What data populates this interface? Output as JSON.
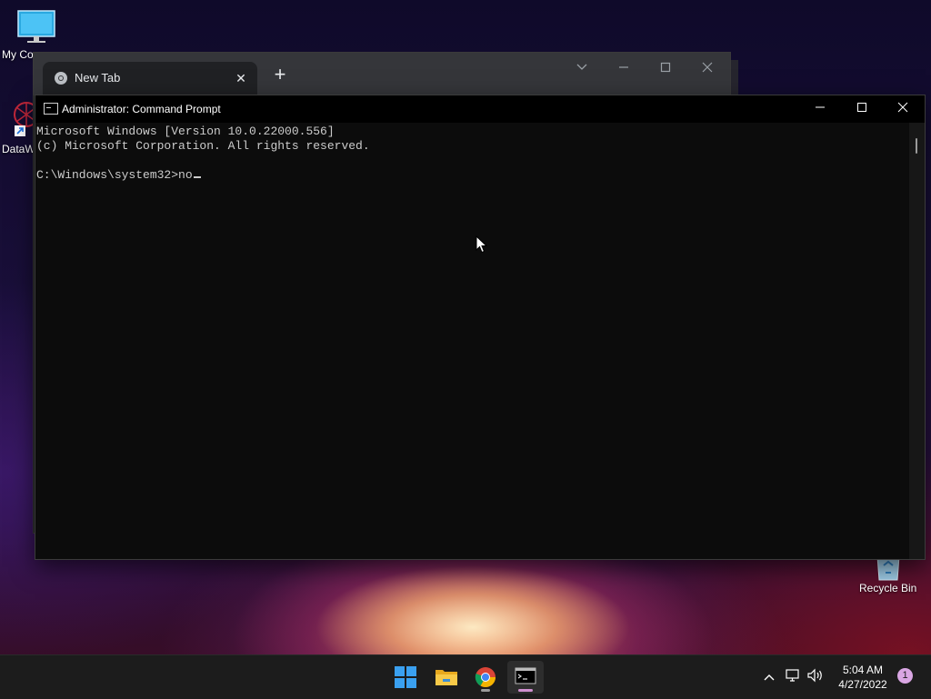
{
  "desktop": {
    "icons": [
      {
        "label": "My Co"
      },
      {
        "label": "DataW"
      },
      {
        "label": "Recycle Bin"
      }
    ]
  },
  "chrome": {
    "tab_title": "New Tab",
    "new_tab_symbol": "+",
    "close_symbol": "✕"
  },
  "cmd": {
    "title": "Administrator: Command Prompt",
    "lines": [
      "Microsoft Windows [Version 10.0.22000.556]",
      "(c) Microsoft Corporation. All rights reserved.",
      "",
      "C:\\Windows\\system32>no"
    ]
  },
  "taskbar": {
    "time": "5:04 AM",
    "date": "4/27/2022",
    "notification_count": "1"
  }
}
